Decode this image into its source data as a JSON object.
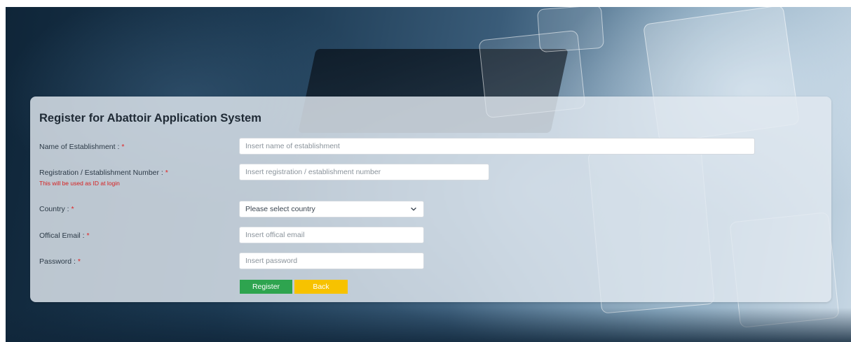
{
  "form": {
    "title": "Register for Abattoir Application System",
    "required_marker": "*",
    "fields": {
      "establishment_name": {
        "label": "Name of Establishment : ",
        "placeholder": "Insert name of establishment",
        "value": ""
      },
      "registration_number": {
        "label": "Registration / Establishment Number : ",
        "hint": "This will be used as ID at login",
        "placeholder": "Insert registration / establishment number",
        "value": ""
      },
      "country": {
        "label": "Country : ",
        "selected": "Please select country",
        "icon": "chevron-down-icon"
      },
      "email": {
        "label": "Offical Email : ",
        "placeholder": "Insert offical email",
        "value": ""
      },
      "password": {
        "label": "Password : ",
        "placeholder": "Insert password",
        "value": ""
      }
    },
    "buttons": {
      "register": "Register",
      "back": "Back"
    }
  },
  "colors": {
    "register_button": "#2ea44f",
    "back_button": "#f7c200",
    "required_marker": "#e02424",
    "hint_text": "#d61f1f"
  }
}
